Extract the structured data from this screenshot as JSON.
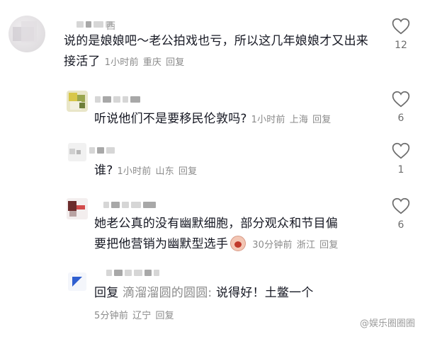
{
  "comments": [
    {
      "text": "说的是娘娘吧～老公拍戏也亏，所以这几年娘娘才又出来接活了",
      "name_tail": "西",
      "time": "1小时前",
      "location": "重庆",
      "reply_label": "回复",
      "likes": "12"
    },
    {
      "text": "听说他们不是要移民伦敦吗?",
      "time": "1小时前",
      "location": "上海",
      "reply_label": "回复",
      "likes": "6"
    },
    {
      "text": "谁?",
      "time": "1小时前",
      "location": "山东",
      "reply_label": "回复",
      "likes": "1"
    },
    {
      "text_line1": "她老公真的没有幽默细胞，部分观众和节目偏",
      "text_line2": "要把他营销为幽默型选手",
      "emoji": "crying-face-emoji",
      "time": "30分钟前",
      "location": "浙江",
      "reply_label": "回复",
      "likes": "6"
    },
    {
      "reply_prefix": "回复",
      "reply_to": "滴溜溜圆的圆圆:",
      "text": "说得好！土鳖一个",
      "time": "5分钟前",
      "location": "辽宁",
      "reply_label": "回复"
    }
  ],
  "watermark": "@娱乐圈圈圈",
  "colors": {
    "text": "#161823",
    "meta": "#8a8a8a",
    "icon": "#6d6d6d"
  }
}
